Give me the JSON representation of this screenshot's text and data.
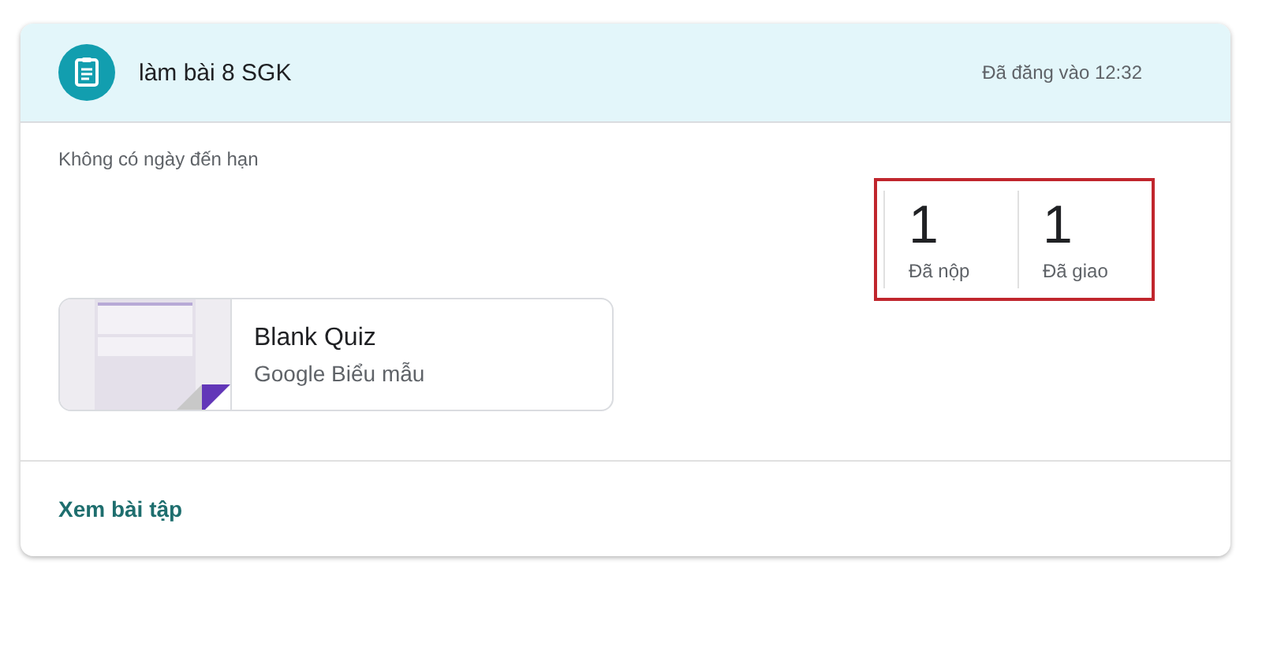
{
  "header": {
    "title": "làm bài 8 SGK",
    "posted": "Đã đăng vào 12:32"
  },
  "due": "Không có ngày đến hạn",
  "stats": {
    "highlighted": true,
    "items": [
      {
        "value": "1",
        "label": "Đã nộp"
      },
      {
        "value": "1",
        "label": "Đã giao"
      }
    ]
  },
  "attachment": {
    "title": "Blank Quiz",
    "subtitle": "Google Biểu mẫu"
  },
  "link": "Xem bài tập"
}
